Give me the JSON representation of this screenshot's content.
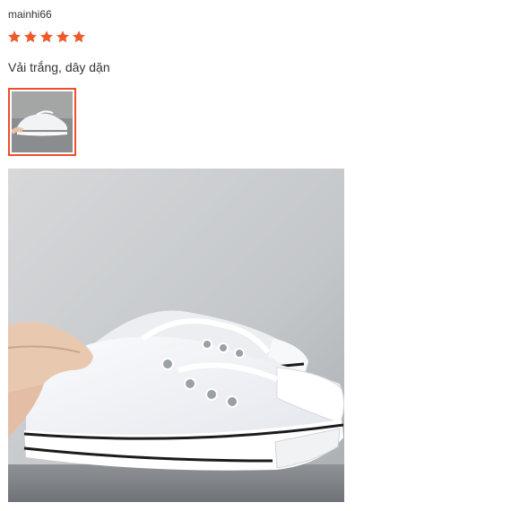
{
  "review": {
    "username": "mainhi66",
    "rating": 5,
    "rating_max": 5,
    "comment": "Vải trắng, dây dặn"
  },
  "colors": {
    "star": "#ee5a2c",
    "thumb_border": "#ee4d2d"
  },
  "icons": {
    "star": "star-icon"
  }
}
